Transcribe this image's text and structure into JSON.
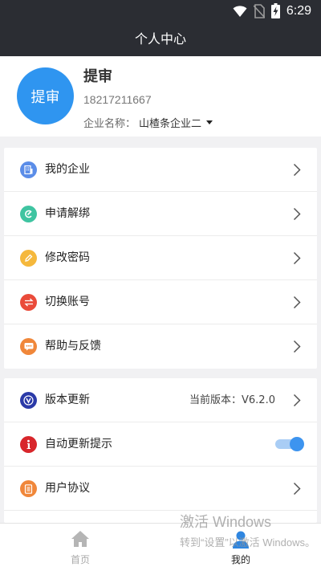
{
  "status_bar": {
    "time": "6:29"
  },
  "header": {
    "title": "个人中心"
  },
  "profile": {
    "avatar_text": "提审",
    "name": "提审",
    "phone": "18217211667",
    "company_label": "企业名称：",
    "company_value": "山楂条企业二"
  },
  "menu1": [
    {
      "label": "我的企业",
      "icon": "building-icon",
      "color": "#5b8de8"
    },
    {
      "label": "申请解绑",
      "icon": "unbind-icon",
      "color": "#3fc4a1"
    },
    {
      "label": "修改密码",
      "icon": "pencil-icon",
      "color": "#f5b83c"
    },
    {
      "label": "切换账号",
      "icon": "switch-icon",
      "color": "#ea4b3a"
    },
    {
      "label": "帮助与反馈",
      "icon": "chat-icon",
      "color": "#f0873a"
    }
  ],
  "menu2": [
    {
      "label": "版本更新",
      "icon": "version-icon",
      "color": "#2b3aa8",
      "extra": "当前版本：V6.2.0"
    },
    {
      "label": "自动更新提示",
      "icon": "info-icon",
      "color": "#d8262b",
      "toggle": true
    },
    {
      "label": "用户协议",
      "icon": "document-icon",
      "color": "#f0873a"
    }
  ],
  "tabs": [
    {
      "label": "首页",
      "icon": "home-icon"
    },
    {
      "label": "我的",
      "icon": "user-icon"
    }
  ],
  "watermark": {
    "line1": "激活 Windows",
    "line2": "转到“设置”以激活 Windows。"
  }
}
